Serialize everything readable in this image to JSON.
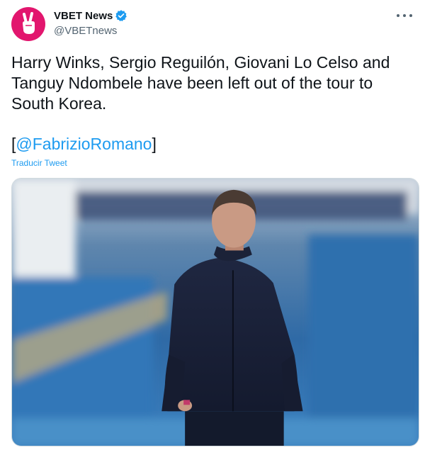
{
  "author": {
    "display_name": "VBET News",
    "handle": "@VBETnews",
    "verified": true,
    "avatar_icon": "peace-hand-icon",
    "avatar_color": "#e2166e"
  },
  "tweet": {
    "text": "Harry Winks, Sergio Reguilón, Giovani Lo Celso and\nTanguy Ndombele have been left out of the tour to\nSouth Korea.",
    "mention_open": "[",
    "mention": "@FabrizioRomano",
    "mention_close": "]",
    "translate_label": "Traducir Tweet"
  },
  "menu": {
    "icon": "more-options-icon"
  },
  "colors": {
    "accent": "#1d9bf0",
    "text": "#0f1419",
    "muted": "#536471"
  }
}
